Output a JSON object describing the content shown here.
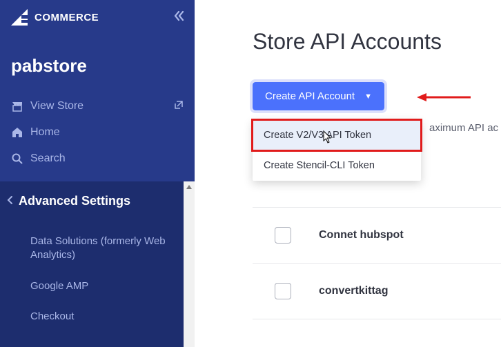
{
  "logo_text": "COMMERCE",
  "store_name": "pabstore",
  "nav": {
    "view_store": "View Store",
    "home": "Home",
    "search": "Search"
  },
  "section": {
    "title": "Advanced Settings",
    "items": [
      "Data Solutions (formerly Web Analytics)",
      "Google AMP",
      "Checkout"
    ]
  },
  "page_title": "Store API Accounts",
  "create_button": "Create API Account",
  "dropdown": {
    "v2v3": "Create V2/V3 API Token",
    "stencil": "Create Stencil-CLI Token"
  },
  "context_text": "aximum API ac",
  "accounts": [
    "Connet hubspot",
    "convertkittag"
  ]
}
